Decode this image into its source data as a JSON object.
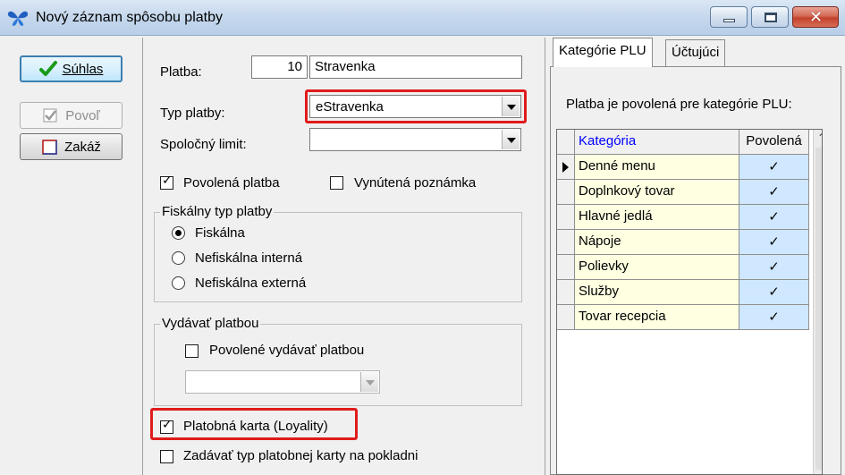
{
  "window": {
    "title": "Nový záznam spôsobu platby",
    "colors": {
      "title_gradient": "#c3d6ec",
      "close_button": "#c2412c",
      "highlight_box": "#e01b1b",
      "grid_category_bg": "#ffffe1",
      "grid_check_bg": "#cfe8ff",
      "grid_header_link": "#0000ff"
    },
    "icons": [
      "butterfly-icon",
      "minimize-icon",
      "maximize-icon",
      "close-icon"
    ]
  },
  "actions": {
    "confirm": {
      "label": "Súhlas",
      "icon": "green-checkmark-icon"
    },
    "allow": {
      "label": "Povoľ",
      "icon": "checked-box-icon",
      "disabled": true
    },
    "forbid": {
      "label": "Zakáž",
      "icon": "empty-box-icon"
    }
  },
  "form": {
    "payment_label": "Platba:",
    "payment_number": "10",
    "payment_name": "Stravenka",
    "type_label": "Typ platby:",
    "type_value": "eStravenka",
    "limit_label": "Spoločný limit:",
    "limit_value": "",
    "allowed_label": "Povolená platba",
    "allowed_checked": true,
    "forced_note_label": "Vynútená poznámka",
    "forced_note_checked": false,
    "fiscal_group_title": "Fiskálny typ platby",
    "fiscal_options": [
      {
        "label": "Fiskálna",
        "selected": true
      },
      {
        "label": "Nefiskálna interná",
        "selected": false
      },
      {
        "label": "Nefiskálna externá",
        "selected": false
      }
    ],
    "issue_group_title": "Vydávať platbou",
    "issue_allowed_label": "Povolené vydávať platbou",
    "issue_allowed_checked": false,
    "issue_combo_value": "",
    "card_label": "Platobná karta (Loyality)",
    "card_checked": true,
    "card_type_label": "Zadávať typ platobnej karty na pokladni",
    "card_type_checked": false
  },
  "tabs": {
    "items": [
      {
        "label": "Kategórie PLU",
        "active": true
      },
      {
        "label": "Účtujúci",
        "active": false
      }
    ],
    "description": "Platba je povolená pre kategórie PLU:",
    "grid": {
      "columns": [
        "Kategória",
        "Povolená"
      ],
      "rows": [
        {
          "category": "Denné menu",
          "allowed": "✓",
          "current": true
        },
        {
          "category": "Doplnkový tovar",
          "allowed": "✓"
        },
        {
          "category": "Hlavné jedlá",
          "allowed": "✓"
        },
        {
          "category": "Nápoje",
          "allowed": "✓"
        },
        {
          "category": "Polievky",
          "allowed": "✓"
        },
        {
          "category": "Služby",
          "allowed": "✓"
        },
        {
          "category": "Tovar recepcia",
          "allowed": "✓"
        }
      ]
    }
  }
}
